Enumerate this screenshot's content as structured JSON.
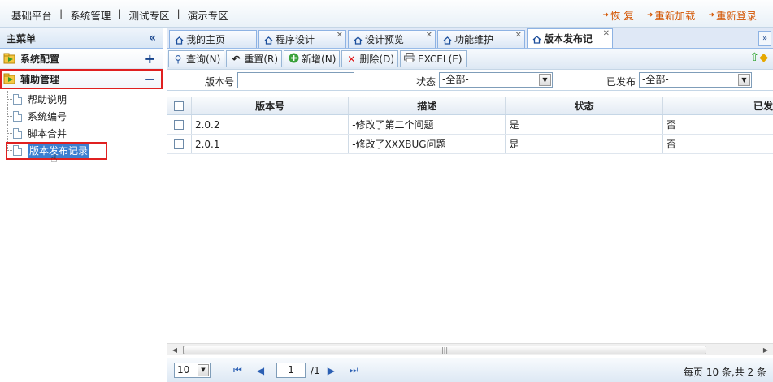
{
  "topnav": {
    "items": [
      "基础平台",
      "系统管理",
      "测试专区",
      "演示专区"
    ],
    "actions": [
      "恢 复",
      "重新加载",
      "重新登录"
    ]
  },
  "sidebar": {
    "title": "主菜单",
    "groups": [
      {
        "label": "系统配置",
        "toggle": "+"
      },
      {
        "label": "辅助管理",
        "toggle": "−"
      }
    ],
    "items": [
      "帮助说明",
      "系统编号",
      "脚本合并",
      "版本发布记录"
    ]
  },
  "tabs": [
    "我的主页",
    "程序设计",
    "设计预览",
    "功能维护",
    "版本发布记"
  ],
  "toolbar": {
    "buttons": [
      "查询(N)",
      "重置(R)",
      "新增(N)",
      "删除(D)",
      "EXCEL(E)"
    ]
  },
  "filter": {
    "version_label": "版本号",
    "version_value": "",
    "status_label": "状态",
    "status_value": "-全部-",
    "published_label": "已发布",
    "published_value": "-全部-"
  },
  "grid": {
    "columns": [
      "版本号",
      "描述",
      "状态",
      "已发"
    ],
    "rows": [
      [
        "2.0.2",
        "-修改了第二个问题",
        "是",
        "否"
      ],
      [
        "2.0.1",
        "-修改了XXXBUG问题",
        "是",
        "否"
      ]
    ]
  },
  "pager": {
    "page_size": "10",
    "current_page": "1",
    "total_pages": "/1",
    "info": "每页 10 条,共 2 条"
  },
  "colors": {
    "accent": "#99bbe8",
    "highlight": "#e02020",
    "action": "#d35400"
  }
}
